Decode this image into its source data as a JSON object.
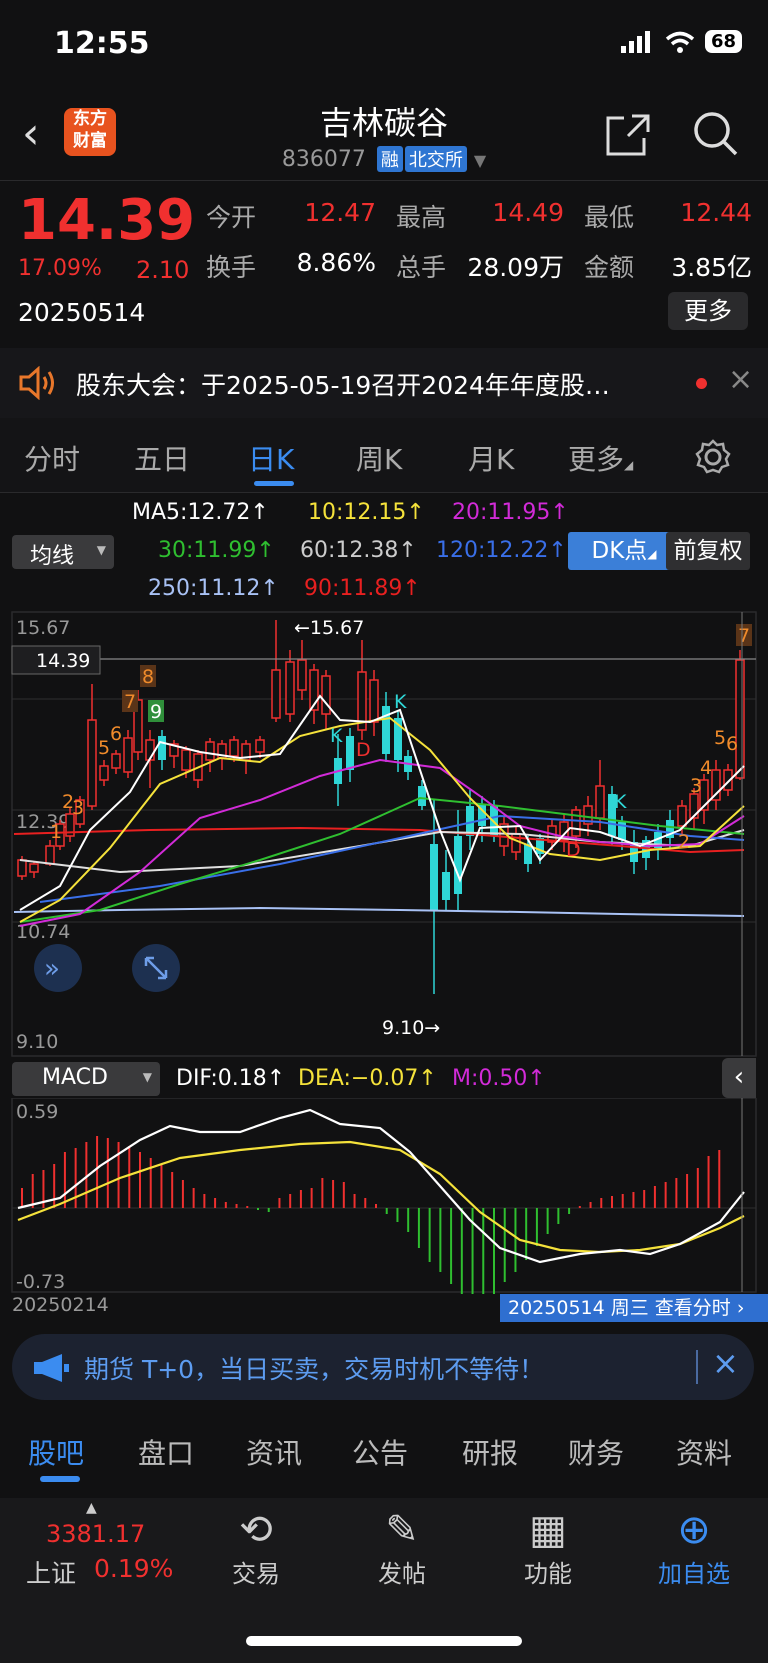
{
  "status": {
    "time": "12:55",
    "battery": "68"
  },
  "header": {
    "logo_line1": "东方",
    "logo_line2": "财富",
    "title": "吉林碳谷",
    "code": "836077",
    "tag_margin": "融",
    "tag_exchange": "北交所"
  },
  "quote": {
    "price": "14.39",
    "change_pct": "17.09%",
    "change_amt": "2.10",
    "date": "20250514",
    "open_label": "今开",
    "open": "12.47",
    "high_label": "最高",
    "high": "14.49",
    "low_label": "最低",
    "low": "12.44",
    "turnover_label": "换手",
    "turnover": "8.86%",
    "volume_label": "总手",
    "volume": "28.09万",
    "amount_label": "金额",
    "amount": "3.85亿",
    "more": "更多"
  },
  "notice": {
    "text": "股东大会：于2025-05-19召开2024年年度股…"
  },
  "tabs": [
    "分时",
    "五日",
    "日K",
    "周K",
    "月K",
    "更多"
  ],
  "indicators": {
    "ma_select": "均线",
    "ma5": "MA5:12.72↑",
    "ma10": "10:12.15↑",
    "ma20": "20:11.95↑",
    "ma30": "30:11.99↑",
    "ma60": "60:12.38↑",
    "ma120": "120:12.22↑",
    "ma250": "250:11.12↑",
    "ma90": "90:11.89↑",
    "dk": "DK点",
    "fq": "前复权"
  },
  "kline": {
    "axis_top": "15.67",
    "axis_mid": "12.39",
    "axis_low": "10.74",
    "axis_bottom": "9.10",
    "price_tag": "14.39",
    "high_mark": "←15.67",
    "low_mark": "9.10→"
  },
  "macd": {
    "select": "MACD",
    "dif": "DIF:0.18↑",
    "dea": "DEA:−0.07↑",
    "m": "M:0.50↑",
    "axis_top": "0.59",
    "axis_bottom": "-0.73",
    "start_date": "20250214",
    "end_label": "20250514 周三 查看分时"
  },
  "banner": {
    "text": "期货 T+0，当日买卖，交易时机不等待！"
  },
  "bottom_tabs": [
    "股吧",
    "盘口",
    "资讯",
    "公告",
    "研报",
    "财务",
    "资料"
  ],
  "nav": {
    "index_value": "3381.17",
    "index_name": "上证",
    "index_pct": "0.19%",
    "trade": "交易",
    "post": "发帖",
    "func": "功能",
    "watch": "加自选"
  },
  "colors": {
    "up": "#f0302f",
    "down": "#2fd6d6",
    "accent": "#3b8cf0"
  }
}
